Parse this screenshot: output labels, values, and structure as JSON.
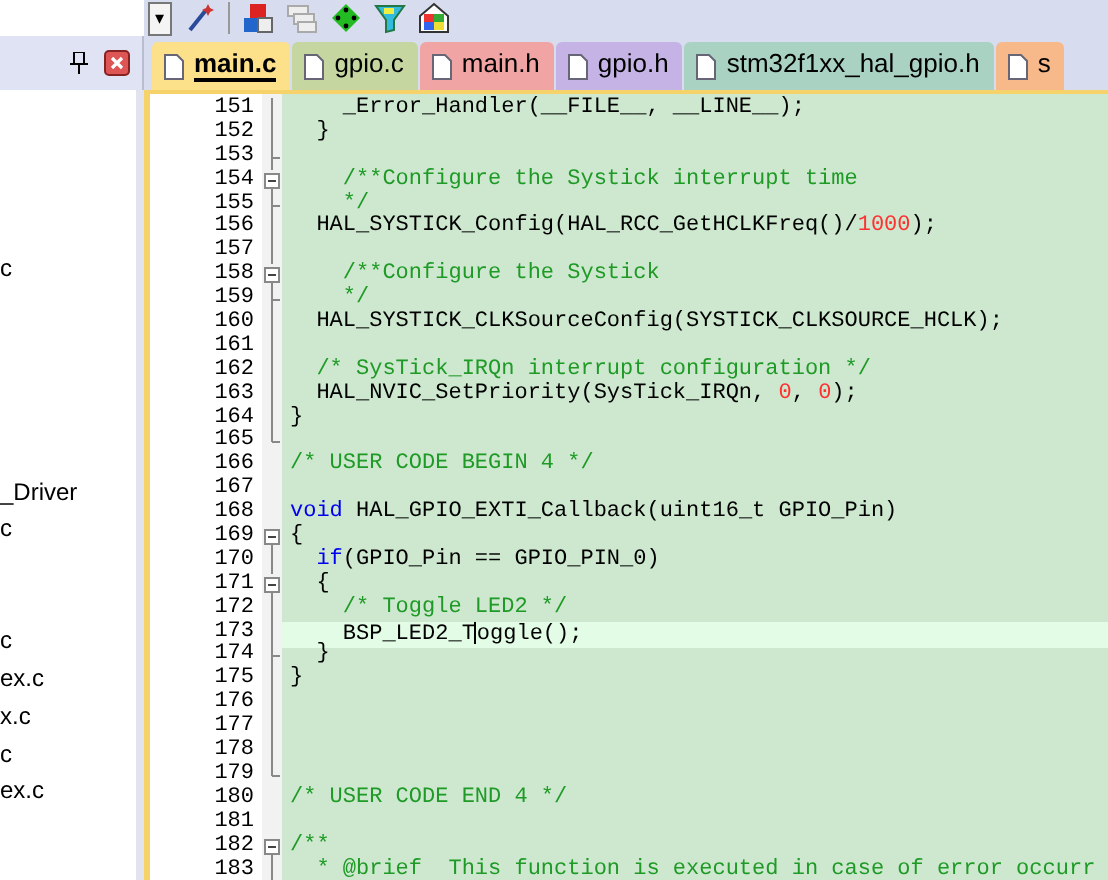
{
  "toolbar": {
    "dropdown": "▾"
  },
  "sidebar": {
    "items": [
      {
        "label": "c",
        "selected": false
      },
      {
        "label": "_Driver",
        "selected": false
      },
      {
        "label": "c",
        "selected": false
      },
      {
        "label": "c",
        "selected": false
      },
      {
        "label": "ex.c",
        "selected": false
      },
      {
        "label": "x.c",
        "selected": false
      },
      {
        "label": "c",
        "selected": false
      },
      {
        "label": "ex.c",
        "selected": false
      }
    ]
  },
  "tabs": [
    {
      "label": "main.c",
      "selected": true,
      "color": "#fde08a"
    },
    {
      "label": "gpio.c",
      "selected": false,
      "color": "#c6d6a0"
    },
    {
      "label": "main.h",
      "selected": false,
      "color": "#f0a4a4"
    },
    {
      "label": "gpio.h",
      "selected": false,
      "color": "#c5b3e6"
    },
    {
      "label": "stm32f1xx_hal_gpio.h",
      "selected": false,
      "color": "#a9d2c2"
    },
    {
      "label": "s",
      "selected": false,
      "color": "#f7b98a"
    }
  ],
  "editor": {
    "lines": [
      {
        "number": "151",
        "fold": {
          "kind": "mid"
        },
        "current": false,
        "segments": [
          {
            "kind": "code",
            "text": "    _Error_Handler(__FILE__, __LINE__);"
          }
        ]
      },
      {
        "number": "152",
        "fold": {
          "kind": "mid"
        },
        "current": false,
        "segments": [
          {
            "kind": "code",
            "text": "  }"
          }
        ]
      },
      {
        "number": "153",
        "fold": {
          "kind": "tick"
        },
        "current": false
      },
      {
        "number": "154",
        "fold": {
          "kind": "start"
        },
        "current": false,
        "segments": [
          {
            "kind": "comment",
            "text": "    /**Configure the Systick interrupt time"
          }
        ]
      },
      {
        "number": "155",
        "fold": {
          "kind": "tick"
        },
        "current": false,
        "segments": [
          {
            "kind": "comment",
            "text": "    */"
          }
        ]
      },
      {
        "number": "156",
        "fold": {
          "kind": "mid"
        },
        "current": false,
        "segments": [
          {
            "kind": "code",
            "text": "  HAL_SYSTICK_Config(HAL_RCC_GetHCLKFreq()/"
          },
          {
            "kind": "number",
            "text": "1000"
          },
          {
            "kind": "code",
            "text": ");"
          }
        ]
      },
      {
        "number": "157",
        "fold": {
          "kind": "mid"
        },
        "current": false
      },
      {
        "number": "158",
        "fold": {
          "kind": "start"
        },
        "current": false,
        "segments": [
          {
            "kind": "comment",
            "text": "    /**Configure the Systick"
          }
        ]
      },
      {
        "number": "159",
        "fold": {
          "kind": "tick"
        },
        "current": false,
        "segments": [
          {
            "kind": "comment",
            "text": "    */"
          }
        ]
      },
      {
        "number": "160",
        "fold": {
          "kind": "mid"
        },
        "current": false,
        "segments": [
          {
            "kind": "code",
            "text": "  HAL_SYSTICK_CLKSourceConfig(SYSTICK_CLKSOURCE_HCLK);"
          }
        ]
      },
      {
        "number": "161",
        "fold": {
          "kind": "mid"
        },
        "current": false
      },
      {
        "number": "162",
        "fold": {
          "kind": "mid"
        },
        "current": false,
        "segments": [
          {
            "kind": "comment",
            "text": "  /* SysTick_IRQn interrupt configuration */"
          }
        ]
      },
      {
        "number": "163",
        "fold": {
          "kind": "mid"
        },
        "current": false,
        "segments": [
          {
            "kind": "code",
            "text": "  HAL_NVIC_SetPriority(SysTick_IRQn, "
          },
          {
            "kind": "number",
            "text": "0"
          },
          {
            "kind": "code",
            "text": ", "
          },
          {
            "kind": "number",
            "text": "0"
          },
          {
            "kind": "code",
            "text": ");"
          }
        ]
      },
      {
        "number": "164",
        "fold": {
          "kind": "mid"
        },
        "current": false,
        "segments": [
          {
            "kind": "code",
            "text": "}"
          }
        ]
      },
      {
        "number": "165",
        "fold": {
          "kind": "end"
        },
        "current": false
      },
      {
        "number": "166",
        "current": false,
        "segments": [
          {
            "kind": "comment",
            "text": "/* USER CODE BEGIN 4 */"
          }
        ]
      },
      {
        "number": "167",
        "current": false
      },
      {
        "number": "168",
        "current": false,
        "segments": [
          {
            "kind": "keyword",
            "text": "void"
          },
          {
            "kind": "code",
            "text": " HAL_GPIO_EXTI_Callback(uint16_t GPIO_Pin)"
          }
        ]
      },
      {
        "number": "169",
        "fold": {
          "kind": "start"
        },
        "current": false,
        "segments": [
          {
            "kind": "code",
            "text": "{"
          }
        ]
      },
      {
        "number": "170",
        "fold": {
          "kind": "mid"
        },
        "current": false,
        "segments": [
          {
            "kind": "keyword",
            "text": "  if"
          },
          {
            "kind": "code",
            "text": "(GPIO_Pin == GPIO_PIN_0)"
          }
        ]
      },
      {
        "number": "171",
        "fold": {
          "kind": "start"
        },
        "current": false,
        "segments": [
          {
            "kind": "code",
            "text": "  {"
          }
        ]
      },
      {
        "number": "172",
        "fold": {
          "kind": "mid"
        },
        "current": false,
        "segments": [
          {
            "kind": "comment",
            "text": "    /* Toggle LED2 */"
          }
        ]
      },
      {
        "number": "173",
        "fold": {
          "kind": "mid"
        },
        "current": true,
        "segments": [
          {
            "kind": "code",
            "text": "    BSP_LED2_T"
          },
          {
            "kind": "caret"
          },
          {
            "kind": "code",
            "text": "oggle();"
          }
        ]
      },
      {
        "number": "174",
        "fold": {
          "kind": "tick"
        },
        "current": false,
        "segments": [
          {
            "kind": "code",
            "text": "  }"
          }
        ]
      },
      {
        "number": "175",
        "fold": {
          "kind": "mid"
        },
        "current": false,
        "segments": [
          {
            "kind": "code",
            "text": "}"
          }
        ]
      },
      {
        "number": "176",
        "fold": {
          "kind": "mid"
        },
        "current": false
      },
      {
        "number": "177",
        "fold": {
          "kind": "mid"
        },
        "current": false
      },
      {
        "number": "178",
        "fold": {
          "kind": "mid"
        },
        "current": false
      },
      {
        "number": "179",
        "fold": {
          "kind": "end"
        },
        "current": false
      },
      {
        "number": "180",
        "current": false,
        "segments": [
          {
            "kind": "comment",
            "text": "/* USER CODE END 4 */"
          }
        ]
      },
      {
        "number": "181",
        "current": false
      },
      {
        "number": "182",
        "fold": {
          "kind": "start"
        },
        "current": false,
        "segments": [
          {
            "kind": "comment",
            "text": "/**"
          }
        ]
      },
      {
        "number": "183",
        "fold": {
          "kind": "mid"
        },
        "current": false,
        "segments": [
          {
            "kind": "comment",
            "text": "  * @brief  This function is executed in case of error occurr"
          }
        ]
      }
    ]
  }
}
